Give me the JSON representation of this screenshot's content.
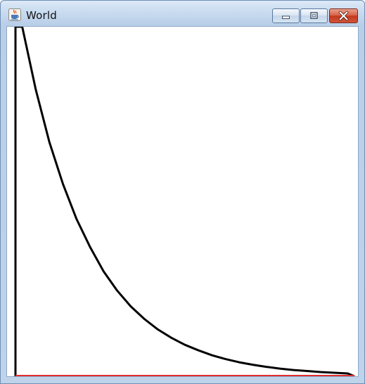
{
  "window": {
    "title": "World",
    "icons": {
      "app": "java-coffee-cup-icon",
      "minimize": "minimize-icon",
      "maximize": "maximize-icon",
      "close": "close-icon"
    }
  },
  "colors": {
    "curve": "#000000",
    "baseline": "#e03030",
    "canvas_background": "#ffffff"
  },
  "chart_data": {
    "type": "line",
    "series": [
      {
        "color": "#000000",
        "points": [
          [
            0.0,
            0.0
          ],
          [
            0.0,
            0.5
          ],
          [
            0.0,
            1.0
          ],
          [
            0.02,
            1.0
          ],
          [
            0.06,
            0.82
          ],
          [
            0.1,
            0.67
          ],
          [
            0.14,
            0.55
          ],
          [
            0.18,
            0.45
          ],
          [
            0.22,
            0.37
          ],
          [
            0.26,
            0.3
          ],
          [
            0.3,
            0.245
          ],
          [
            0.34,
            0.2
          ],
          [
            0.38,
            0.164
          ],
          [
            0.42,
            0.134
          ],
          [
            0.46,
            0.11
          ],
          [
            0.5,
            0.09
          ],
          [
            0.54,
            0.074
          ],
          [
            0.58,
            0.06
          ],
          [
            0.62,
            0.049
          ],
          [
            0.66,
            0.04
          ],
          [
            0.7,
            0.033
          ],
          [
            0.74,
            0.027
          ],
          [
            0.78,
            0.022
          ],
          [
            0.82,
            0.018
          ],
          [
            0.86,
            0.015
          ],
          [
            0.9,
            0.012
          ],
          [
            0.94,
            0.01
          ],
          [
            0.98,
            0.008
          ],
          [
            1.0,
            0.0
          ]
        ]
      },
      {
        "color": "#e03030",
        "points": [
          [
            0.0,
            0.0
          ],
          [
            1.0,
            0.0
          ]
        ]
      }
    ],
    "xlim": [
      0,
      1
    ],
    "ylim": [
      0,
      1
    ],
    "grid": false
  }
}
